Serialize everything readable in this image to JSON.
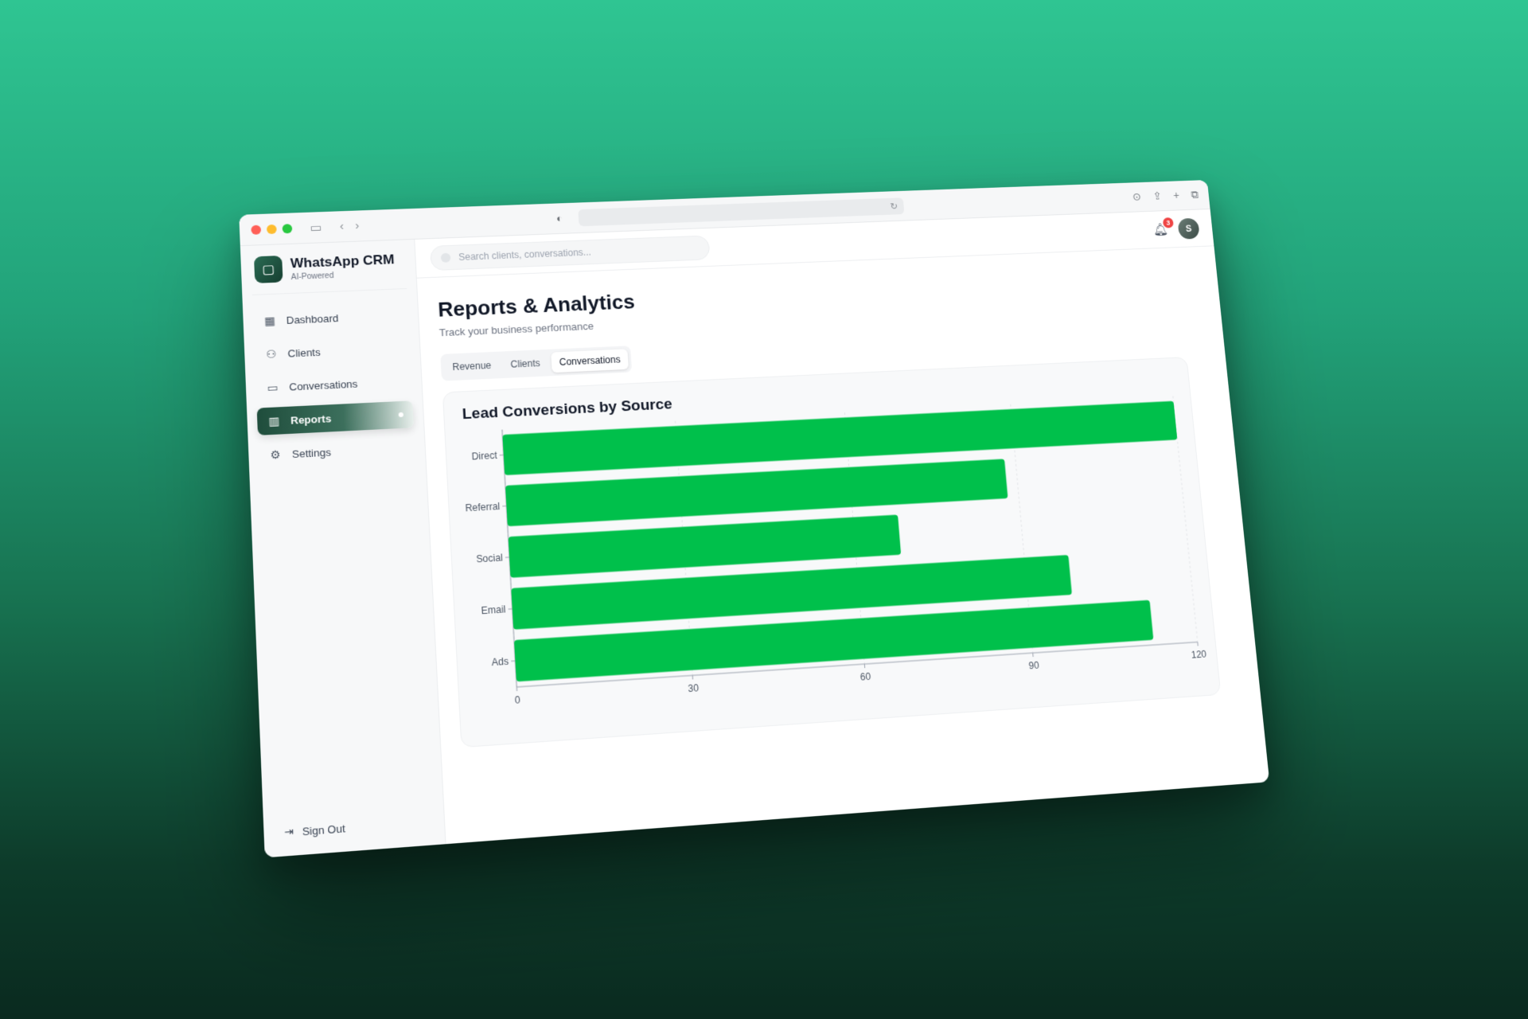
{
  "app": {
    "name": "WhatsApp CRM",
    "subtitle": "AI-Powered"
  },
  "sidebar": {
    "items": [
      {
        "label": "Dashboard",
        "icon": "dashboard-icon"
      },
      {
        "label": "Clients",
        "icon": "users-icon"
      },
      {
        "label": "Conversations",
        "icon": "chat-icon"
      },
      {
        "label": "Reports",
        "icon": "bar-chart-icon",
        "active": true
      },
      {
        "label": "Settings",
        "icon": "gear-icon"
      }
    ],
    "signout": "Sign Out"
  },
  "topbar": {
    "search_placeholder": "Search clients, conversations...",
    "notification_count": "3",
    "avatar_initial": "S"
  },
  "page": {
    "title": "Reports & Analytics",
    "subtitle": "Track your business performance"
  },
  "tabs": [
    {
      "label": "Revenue"
    },
    {
      "label": "Clients"
    },
    {
      "label": "Conversations",
      "active": true
    }
  ],
  "colors": {
    "bar": "#00c04b",
    "accent": "#1f4d3c"
  },
  "chart_data": {
    "type": "bar",
    "orientation": "horizontal",
    "title": "Lead Conversions by Source",
    "categories": [
      "Direct",
      "Referral",
      "Social",
      "Email",
      "Ads"
    ],
    "values": [
      120,
      88,
      68,
      98,
      112
    ],
    "xlim": [
      0,
      120
    ],
    "xticks": [
      0,
      30,
      60,
      90,
      120
    ],
    "grid": true
  }
}
